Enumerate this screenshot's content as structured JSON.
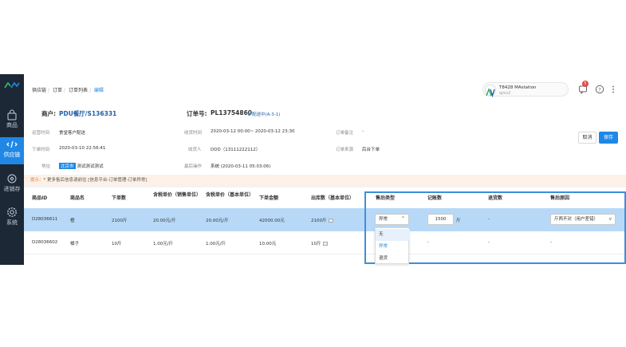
{
  "sidebar": {
    "items": [
      {
        "label": "商品",
        "icon": "bag-icon"
      },
      {
        "label": "供应链",
        "icon": "supply-chain-icon",
        "active": true
      },
      {
        "label": "进销存",
        "icon": "inventory-icon"
      },
      {
        "label": "系统",
        "icon": "gear-icon"
      }
    ]
  },
  "header": {
    "breadcrumb": [
      "供应链",
      "订单",
      "订单列表",
      "编辑"
    ],
    "user": {
      "name": "T8428 MAstation",
      "sub": "qzcs2",
      "avatar": "AV"
    },
    "notification_count": "5"
  },
  "order": {
    "merchant_label": "商户:",
    "merchant_value": "PDU餐厅/S136331",
    "order_no_label": "订单号:",
    "order_no_value": "PL13754860",
    "status": "配送中(A-3-1)",
    "cancel_label": "取消",
    "save_label": "保存",
    "fields": {
      "operate_time_label": "运营时间",
      "operate_time_value": "食堂客户配送",
      "receive_time_label": "收货时间",
      "receive_time_value": "2020-03-12 00:00~ 2020-03-12 23:30",
      "order_remark_label": "订单备注",
      "order_remark_value": "-",
      "order_time_label": "下单时间",
      "order_time_value": "2020-03-10 22:56:41",
      "receiver_label": "收货人",
      "receiver_value": "DDD（13111222112）",
      "order_source_label": "订单来源",
      "order_source_value": "后台下单",
      "address_label": "地址",
      "address_tag": "北京市",
      "address_value": "测试测试测试",
      "last_op_label": "最后操作",
      "last_op_value": "系统 (2020-03-11 05:03:06)"
    }
  },
  "tip": {
    "prefix": "提示：",
    "text": "* 更多售后信息请前往 [信息平台-订单管理-订单异常]"
  },
  "table": {
    "headers": [
      "商品ID",
      "商品名",
      "下单数",
      "含税单价（销售单位）",
      "含税单价（基本单位）",
      "下单金额",
      "出库数（基本单位）",
      "售后类型",
      "记账数",
      "退货数",
      "售后原因"
    ],
    "rows": [
      {
        "id": "D28036611",
        "name": "橙",
        "qty": "2100斤",
        "price_sale": "20.00元/斤",
        "price_base": "20.00元/斤",
        "amount": "42000.00元",
        "out_qty": "2100斤",
        "after_type": "异常",
        "account_qty": "1500",
        "account_unit": "斤",
        "return_qty": "-",
        "reason": "斤两不对（用户差错）"
      },
      {
        "id": "D28036602",
        "name": "橘子",
        "qty": "10斤",
        "price_sale": "1.00元/斤",
        "price_base": "1.00元/斤",
        "amount": "10.00元",
        "out_qty": "10斤",
        "after_type": "",
        "account_qty": "-",
        "account_unit": "",
        "return_qty": "-",
        "reason": "-"
      }
    ],
    "dropdown_options": [
      "无",
      "异常",
      "退货"
    ]
  },
  "colors": {
    "accent": "#1f87e5",
    "sidebar": "#1c2836",
    "highlight_row": "#b7d9f7"
  }
}
